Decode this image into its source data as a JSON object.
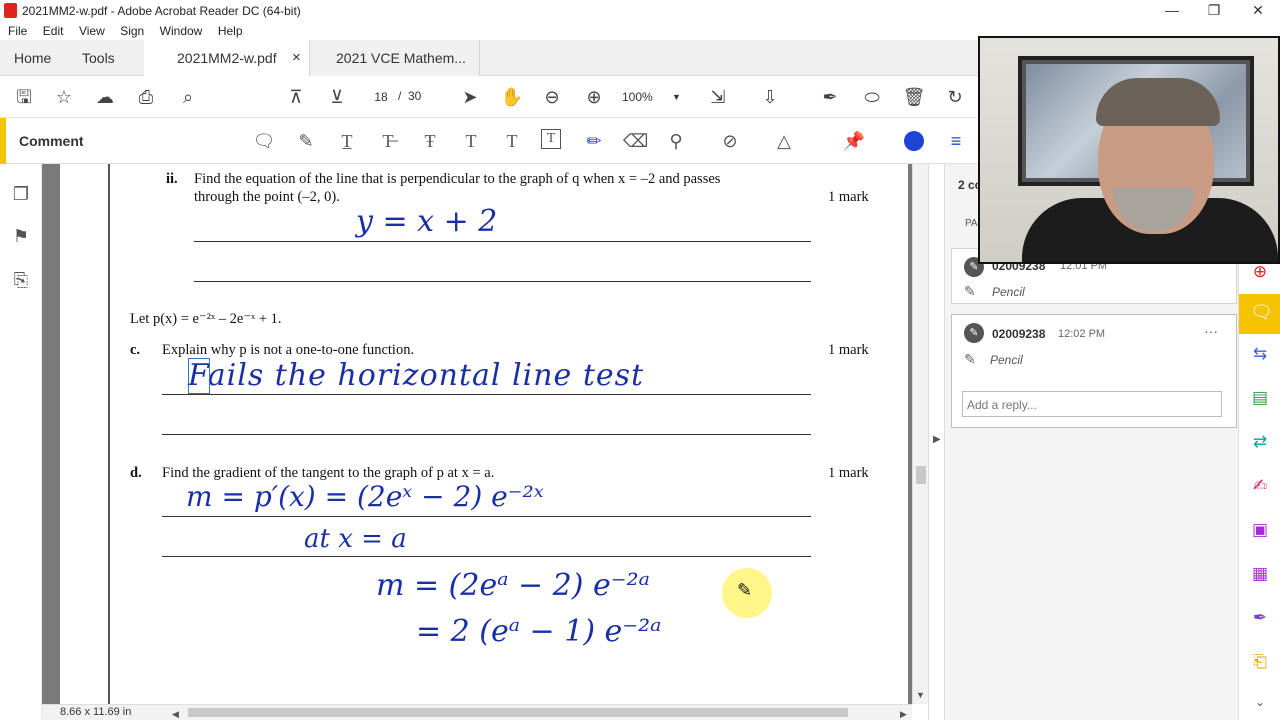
{
  "window": {
    "title": "2021MM2-w.pdf - Adobe Acrobat Reader DC (64-bit)",
    "minimize": "—",
    "restore": "❐",
    "close": "✕"
  },
  "menu": [
    "File",
    "Edit",
    "View",
    "Sign",
    "Window",
    "Help"
  ],
  "tabs": {
    "home": "Home",
    "tools": "Tools",
    "doc1": "2021MM2-w.pdf",
    "doc1_close": "×",
    "doc2": "2021 VCE Mathem..."
  },
  "toolbar": {
    "page_current": "18",
    "page_sep": "/",
    "page_total": "30",
    "zoom": "100%"
  },
  "commentbar": {
    "label": "Comment",
    "accent_color": "#f5c400",
    "fill_color": "#1d44d6"
  },
  "document": {
    "q_ii_label": "ii.",
    "q_ii_line1": "Find the equation of the line that is perpendicular to the graph of q when x = –2 and passes",
    "q_ii_line2": "through the point (–2, 0).",
    "q_ii_mark": "1 mark",
    "q_ii_answer": "y = x + 2",
    "let_p": "Let p(x) = e⁻²ˣ – 2e⁻ˣ + 1.",
    "q_c_label": "c.",
    "q_c_text": "Explain why p is not a one-to-one function.",
    "q_c_mark": "1 mark",
    "q_c_answer": "Fails the horizontal line test",
    "q_d_label": "d.",
    "q_d_text": "Find the gradient of the tangent to the graph of p at x = a.",
    "q_d_mark": "1 mark",
    "q_d_line1": "m = p′(x) = (2eˣ − 2) e⁻²ˣ",
    "q_d_line2": "at x = a",
    "q_d_line3": "m = (2eᵃ − 2) e⁻²ᵃ",
    "q_d_line4": "= 2 (eᵃ − 1) e⁻²ᵃ",
    "ink_color": "#1a2fa6"
  },
  "status": {
    "page_size": "8.66 x 11.69 in"
  },
  "comments_panel": {
    "header": "2 co",
    "page_label": "PA",
    "comments": [
      {
        "author": "02009238",
        "time": "12:01 PM",
        "tool": "Pencil"
      },
      {
        "author": "02009238",
        "time": "12:02 PM",
        "tool": "Pencil",
        "more": "···"
      }
    ],
    "reply_placeholder": "Add a reply..."
  }
}
